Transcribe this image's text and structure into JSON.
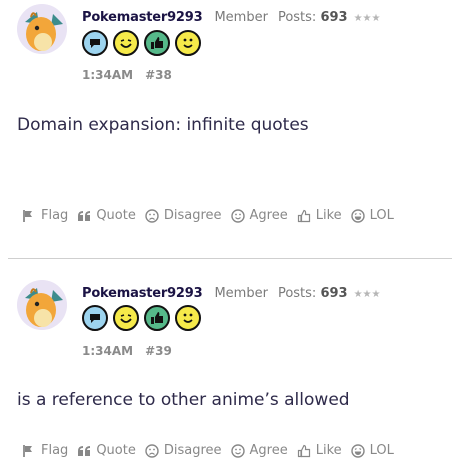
{
  "posts": [
    {
      "username": "Pokemaster9293",
      "role": "Member",
      "posts_label": "Posts:",
      "posts_count": "693",
      "stars": "★★★",
      "badges": [
        "speech-bubble-badge",
        "wink-badge",
        "thumbs-up-badge",
        "smile-badge"
      ],
      "time": "1:34AM",
      "number": "#38",
      "text": "Domain expansion: infinite quotes",
      "actions": [
        "Flag",
        "Quote",
        "Disagree",
        "Agree",
        "Like",
        "LOL"
      ]
    },
    {
      "username": "Pokemaster9293",
      "role": "Member",
      "posts_label": "Posts:",
      "posts_count": "693",
      "stars": "★★★",
      "badges": [
        "speech-bubble-badge",
        "wink-badge",
        "thumbs-up-badge",
        "smile-badge"
      ],
      "time": "1:34AM",
      "number": "#39",
      "text": "is a reference to other anime’s allowed",
      "actions": [
        "Flag",
        "Quote",
        "Disagree",
        "Agree",
        "Like",
        "LOL"
      ]
    }
  ],
  "colors": {
    "username": "#1b1344",
    "muted": "#888888",
    "badge_blue": "#9dd4ef",
    "badge_yellow": "#f6ea4a",
    "badge_green": "#56b98a"
  }
}
